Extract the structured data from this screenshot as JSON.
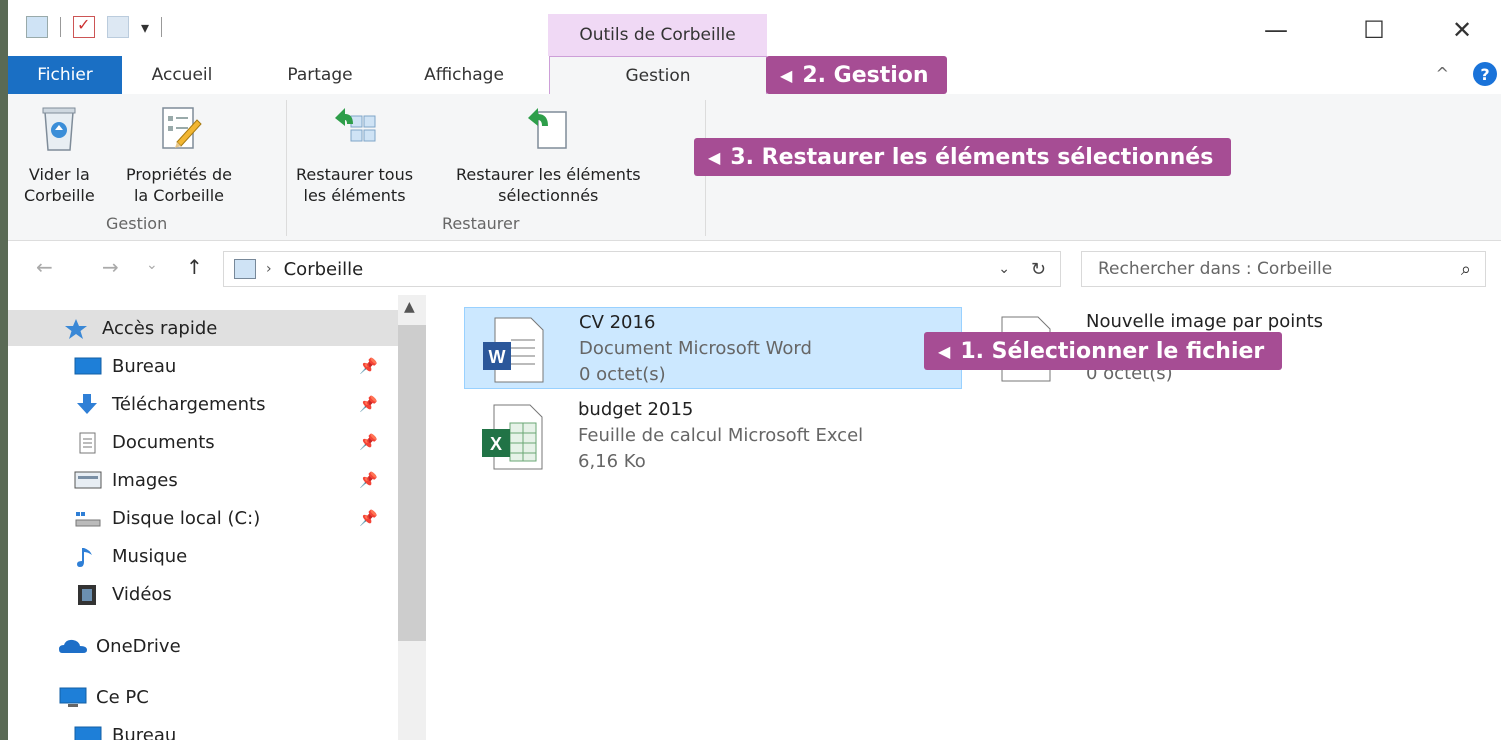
{
  "quick_access_toolbar": {
    "dropdown": "▾"
  },
  "context_tab": {
    "label": "Outils de Corbeille"
  },
  "window_controls": {
    "minimize": "—",
    "maximize": "☐",
    "close": "✕"
  },
  "tabs": {
    "file": "Fichier",
    "home": "Accueil",
    "share": "Partage",
    "view": "Affichage",
    "manage": "Gestion",
    "collapse": "^",
    "help": "?"
  },
  "ribbon": {
    "empty_bin": {
      "line1": "Vider la",
      "line2": "Corbeille"
    },
    "bin_properties": {
      "line1": "Propriétés de",
      "line2": "la Corbeille"
    },
    "group_manage": "Gestion",
    "restore_all": {
      "line1": "Restaurer tous",
      "line2": "les éléments"
    },
    "restore_selected": {
      "line1": "Restaurer les éléments",
      "line2": "sélectionnés"
    },
    "group_restore": "Restaurer"
  },
  "callouts": {
    "step1": "1. Sélectionner le fichier",
    "step2": "2. Gestion",
    "step3": "3. Restaurer les éléments sélectionnés"
  },
  "navigation": {
    "back": "←",
    "forward": "→",
    "recent": "⌄",
    "up": "↑",
    "separator": "›",
    "location": "Corbeille",
    "dropdown": "⌄",
    "refresh": "↻"
  },
  "search": {
    "placeholder": "Rechercher dans : Corbeille",
    "icon": "⌕"
  },
  "sidebar": {
    "items": [
      {
        "label": "Accès rapide",
        "icon": "star-icon"
      },
      {
        "label": "Bureau",
        "icon": "desktop-icon"
      },
      {
        "label": "Téléchargements",
        "icon": "download-icon"
      },
      {
        "label": "Documents",
        "icon": "documents-icon"
      },
      {
        "label": "Images",
        "icon": "images-icon"
      },
      {
        "label": "Disque local (C:)",
        "icon": "drive-icon"
      },
      {
        "label": "Musique",
        "icon": "music-icon"
      },
      {
        "label": "Vidéos",
        "icon": "video-icon"
      },
      {
        "label": "OneDrive",
        "icon": "onedrive-icon"
      },
      {
        "label": "Ce PC",
        "icon": "pc-icon"
      },
      {
        "label": "Bureau",
        "icon": "desktop-icon"
      }
    ],
    "pin": "📌"
  },
  "files": [
    {
      "name": "CV 2016",
      "type": "Document Microsoft Word",
      "size": "0 octet(s)",
      "selected": true
    },
    {
      "name": "Nouvelle image par points",
      "type": "",
      "size": "0 octet(s)",
      "selected": false
    },
    {
      "name": "budget 2015",
      "type": "Feuille de calcul Microsoft Excel",
      "size": "6,16 Ko",
      "selected": false
    }
  ],
  "colors": {
    "accent": "#1a6fc4",
    "callout": "#a64d94",
    "context_tab": "#f0d9f5",
    "selection": "#cce8ff"
  }
}
